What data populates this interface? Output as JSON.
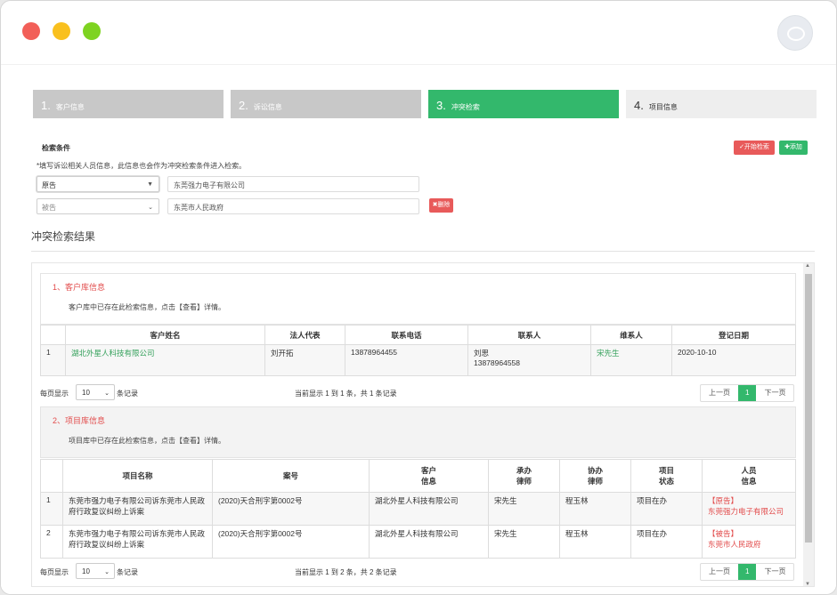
{
  "steps": [
    {
      "num": "1.",
      "label": "客户信息"
    },
    {
      "num": "2.",
      "label": "诉讼信息"
    },
    {
      "num": "3.",
      "label": "冲突检索"
    },
    {
      "num": "4.",
      "label": "项目信息"
    }
  ],
  "search": {
    "title": "检索条件",
    "note": "*填写诉讼相关人员信息，此信息也会作为冲突检索条件进入检索。",
    "start_btn": "✓开始检索",
    "add_btn": "✚添加",
    "row1_role": "原告",
    "row1_value": "东莞强力电子有限公司",
    "row2_role": "被告",
    "row2_value": "东莞市人民政府",
    "del_btn": "✖删除"
  },
  "results_title": "冲突检索结果",
  "client_section": {
    "title": "1、客户库信息",
    "text": "客户库中已存在此检索信息，点击【查看】详情。",
    "headers": [
      "",
      "客户姓名",
      "法人代表",
      "联系电话",
      "联系人",
      "维系人",
      "登记日期"
    ],
    "rows": [
      {
        "no": "1",
        "name": "湖北外星人科技有限公司",
        "rep": "刘开拓",
        "phone": "13878964455",
        "contact_name": "刘思",
        "contact_phone": "13878964558",
        "keeper": "宋先生",
        "date": "2020-10-10"
      }
    ],
    "pager": {
      "prefix": "每页显示",
      "size": "10",
      "suffix": "条记录",
      "info": "当前显示 1 到 1 条，共 1 条记录",
      "prev": "上一页",
      "page": "1",
      "next": "下一页"
    }
  },
  "project_section": {
    "title": "2、项目库信息",
    "text": "项目库中已存在此检索信息，点击【查看】详情。",
    "headers": {
      "no": "",
      "name": "项目名称",
      "case_no": "案号",
      "client_1": "客户",
      "client_2": "信息",
      "lawyer_1": "承办",
      "lawyer_2": "律师",
      "assist_1": "协办",
      "assist_2": "律师",
      "status_1": "项目",
      "status_2": "状态",
      "person_1": "人员",
      "person_2": "信息"
    },
    "rows": [
      {
        "no": "1",
        "name": "东莞市强力电子有限公司诉东莞市人民政府行政复议纠纷上诉案",
        "case_no": "(2020)天合刑字第0002号",
        "client": "湖北外星人科技有限公司",
        "lawyer": "宋先生",
        "assist": "程玉林",
        "status": "项目在办",
        "role": "【原告】",
        "person": "东莞强力电子有限公司"
      },
      {
        "no": "2",
        "name": "东莞市强力电子有限公司诉东莞市人民政府行政复议纠纷上诉案",
        "case_no": "(2020)天合刑字第0002号",
        "client": "湖北外星人科技有限公司",
        "lawyer": "宋先生",
        "assist": "程玉林",
        "status": "项目在办",
        "role": "【被告】",
        "person": "东莞市人民政府"
      }
    ],
    "pager": {
      "prefix": "每页显示",
      "size": "10",
      "suffix": "条记录",
      "info": "当前显示 1 到 2 条，共 2 条记录",
      "prev": "上一页",
      "page": "1",
      "next": "下一页"
    }
  }
}
